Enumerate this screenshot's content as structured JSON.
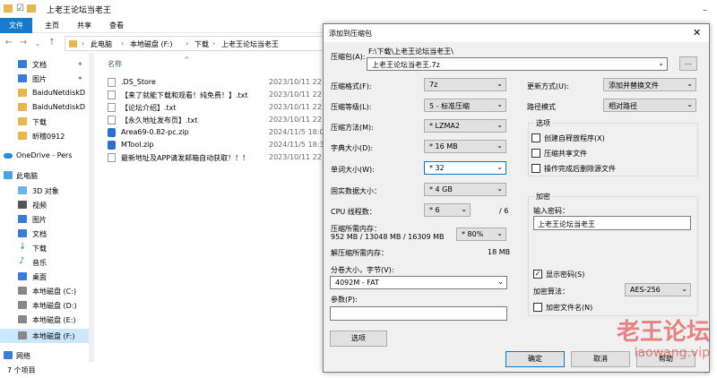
{
  "explorer": {
    "title": "上老王论坛当老王",
    "ribbon_tabs": [
      "文件",
      "主页",
      "共享",
      "查看"
    ],
    "breadcrumb": [
      "此电脑",
      "本地磁盘 (F:)",
      "下载",
      "上老王论坛当老王"
    ],
    "column_name": "名称",
    "nav_items": [
      {
        "label": "文档",
        "icon": "document-icon",
        "pinned": true
      },
      {
        "label": "图片",
        "icon": "pictures-icon",
        "pinned": true
      },
      {
        "label": "BaiduNetdiskD",
        "icon": "folder-icon"
      },
      {
        "label": "BaiduNetdiskD",
        "icon": "folder-icon"
      },
      {
        "label": "下载",
        "icon": "folder-icon"
      },
      {
        "label": "昕稽0912",
        "icon": "folder-icon"
      },
      {
        "label": "OneDrive - Pers",
        "icon": "onedrive-icon"
      },
      {
        "label": "此电脑",
        "icon": "pc-icon"
      },
      {
        "label": "3D 对象",
        "icon": "3d-objects-icon"
      },
      {
        "label": "视频",
        "icon": "video-icon"
      },
      {
        "label": "图片",
        "icon": "pictures-icon"
      },
      {
        "label": "文档",
        "icon": "document-icon"
      },
      {
        "label": "下载",
        "icon": "download-icon"
      },
      {
        "label": "音乐",
        "icon": "music-icon"
      },
      {
        "label": "桌面",
        "icon": "desktop-icon"
      },
      {
        "label": "本地磁盘 (C:)",
        "icon": "drive-icon"
      },
      {
        "label": "本地磁盘 (D:)",
        "icon": "drive-icon"
      },
      {
        "label": "本地磁盘 (E:)",
        "icon": "drive-icon"
      },
      {
        "label": "本地磁盘 (F:)",
        "icon": "drive-icon",
        "selected": true
      },
      {
        "label": "网络",
        "icon": "network-icon"
      }
    ],
    "files": [
      {
        "name": ".DS_Store",
        "date": "2023/10/11 22",
        "icon": "file-icon"
      },
      {
        "name": "【来了就能下载和观看！纯免费！】.txt",
        "date": "2023/10/11 22",
        "icon": "text-file-icon"
      },
      {
        "name": "【论坛介绍】.txt",
        "date": "2023/10/11 22",
        "icon": "text-file-icon"
      },
      {
        "name": "【永久地址发布页】.txt",
        "date": "2023/10/11 22",
        "icon": "text-file-icon"
      },
      {
        "name": "Area69-0.82-pc.zip",
        "date": "2024/11/5 18:0",
        "icon": "zip-icon"
      },
      {
        "name": "MTool.zip",
        "date": "2024/11/5 18:3",
        "icon": "zip-icon"
      },
      {
        "name": "最新地址及APP请发邮箱自动获取！！！",
        "date": "2023/10/11 22",
        "icon": "file-icon"
      }
    ],
    "status": "7 个项目"
  },
  "dialog": {
    "title": "添加到压缩包",
    "archive_label": "压缩包(A):",
    "archive_path": "F:\\下载\\上老王论坛当老王\\",
    "archive_name": "上老王论坛当老王.7z",
    "browse_label": "...",
    "format_label": "压缩格式(F):",
    "format_value": "7z",
    "level_label": "压缩等级(L):",
    "level_value": "5 - 标准压缩",
    "method_label": "压缩方法(M):",
    "method_value": "* LZMA2",
    "dict_label": "字典大小(D):",
    "dict_value": "* 16 MB",
    "word_label": "单词大小(W):",
    "word_value": "* 32",
    "solid_label": "固实数据大小：",
    "solid_value": "* 4 GB",
    "threads_label": "CPU 线程数：",
    "threads_value": "* 6",
    "threads_total": "/ 6",
    "mem_label": "压缩所需内存：",
    "mem_value": "952 MB / 13048 MB / 16309 MB",
    "mem_pct": "* 80%",
    "decomp_label": "解压缩所需内存：",
    "decomp_value": "18 MB",
    "split_label": "分卷大小，字节(V):",
    "split_value": "4092M - FAT",
    "params_label": "参数(P):",
    "params_value": "",
    "options_button": "选项",
    "update_label": "更新方式(U):",
    "update_value": "添加并替换文件",
    "path_label": "路径模式",
    "path_value": "相对路径",
    "options_group": "选项",
    "opt_sfx": "创建自释放程序(X)",
    "opt_shared": "压缩共享文件",
    "opt_delete": "操作完成后删除源文件",
    "encrypt_group": "加密",
    "pwd_label": "输入密码：",
    "pwd_value": "上老王论坛当老王",
    "show_pwd": "显示密码(S)",
    "show_pwd_checked": true,
    "enc_method_label": "加密算法：",
    "enc_method_value": "AES-256",
    "enc_names": "加密文件名(N)",
    "ok": "确定",
    "cancel": "取消",
    "help": "帮助"
  },
  "watermark": {
    "line1": "老王论坛",
    "line2": "laowang.vip"
  }
}
